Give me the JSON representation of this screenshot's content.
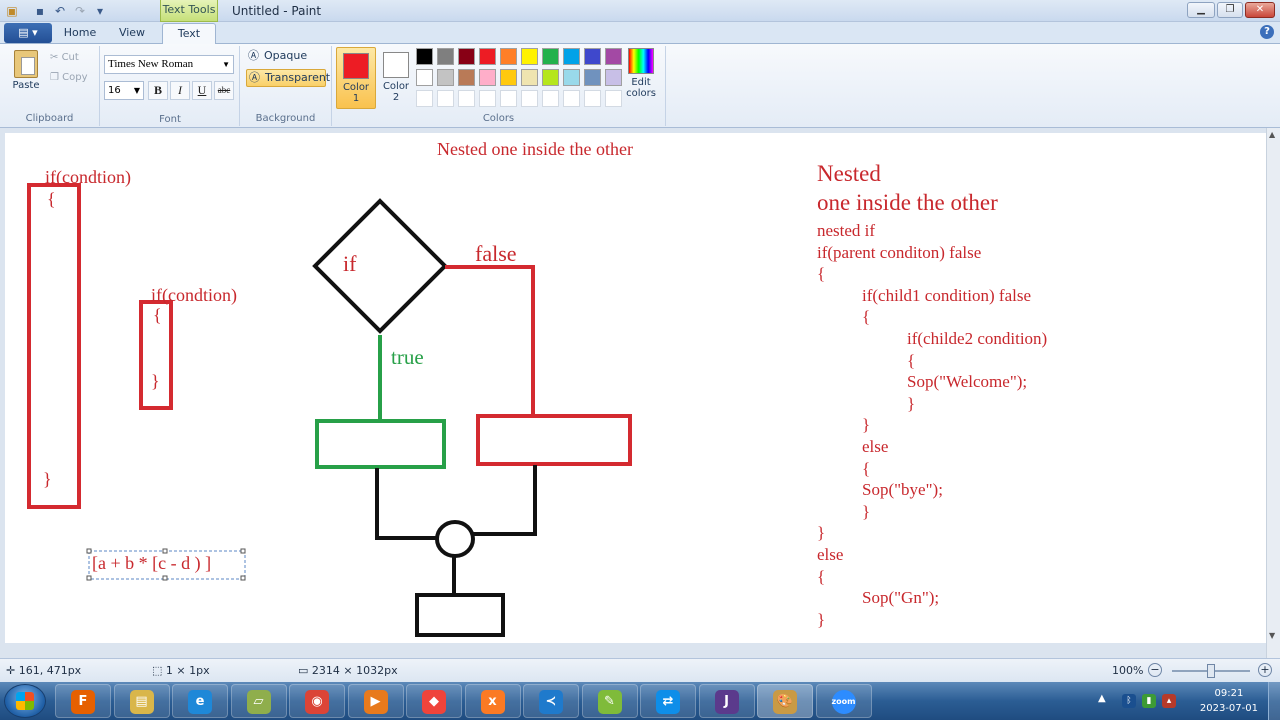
{
  "window": {
    "title": "Untitled - Paint",
    "context_tab": "Text Tools"
  },
  "tabs": [
    {
      "label": "Home"
    },
    {
      "label": "View"
    },
    {
      "label": "Text"
    }
  ],
  "ribbon": {
    "clipboard": {
      "paste": "Paste",
      "cut": "Cut",
      "copy": "Copy",
      "label": "Clipboard"
    },
    "font": {
      "name": "Times New Roman",
      "size": "16",
      "bold": "B",
      "italic": "I",
      "underline": "U",
      "strike": "abc",
      "label": "Font"
    },
    "background": {
      "opaque": "Opaque",
      "transparent": "Transparent",
      "label": "Background"
    },
    "colors": {
      "color1": {
        "label": "Color",
        "num": "1",
        "value": "#ed1c24"
      },
      "color2": {
        "label": "Color",
        "num": "2",
        "value": "#ffffff"
      },
      "edit_label": "Edit",
      "edit_label2": "colors",
      "label": "Colors",
      "palette_row1": [
        "#000000",
        "#7f7f7f",
        "#880015",
        "#ed1c24",
        "#ff7f27",
        "#fff200",
        "#22b14c",
        "#00a2e8",
        "#3f48cc",
        "#a349a4"
      ],
      "palette_row2": [
        "#ffffff",
        "#c3c3c3",
        "#b97a57",
        "#ffaec9",
        "#ffc90e",
        "#efe4b0",
        "#b5e61d",
        "#99d9ea",
        "#7092be",
        "#c8bfe7"
      ],
      "palette_row3": [
        "#ffffff",
        "#ffffff",
        "#ffffff",
        "#ffffff",
        "#ffffff",
        "#ffffff",
        "#ffffff",
        "#ffffff",
        "#ffffff",
        "#ffffff"
      ]
    }
  },
  "canvas": {
    "top_title": "Nested one inside the other",
    "outer_if": "if(condtion)",
    "outer_open": "{",
    "outer_close": "}",
    "inner_if": "if(condtion)",
    "inner_open": "{",
    "inner_close": "}",
    "expression": "[a + b * [c - d ) ]",
    "diamond_label": "if",
    "false_label": "false",
    "true_label": "true",
    "right_heading1": "Nested",
    "right_heading2": "one inside the other",
    "code_lines": [
      {
        "text": "nested if",
        "indent": 0
      },
      {
        "text": "if(parent conditon) false",
        "indent": 0
      },
      {
        "text": "{",
        "indent": 0
      },
      {
        "text": "if(child1 condition) false",
        "indent": 1
      },
      {
        "text": "{",
        "indent": 1
      },
      {
        "text": "if(childe2 condition)",
        "indent": 2
      },
      {
        "text": "{",
        "indent": 2
      },
      {
        "text": "Sop(\"Welcome\");",
        "indent": 2
      },
      {
        "text": "}",
        "indent": 2
      },
      {
        "text": "}",
        "indent": 1
      },
      {
        "text": "else",
        "indent": 1
      },
      {
        "text": "{",
        "indent": 1
      },
      {
        "text": "Sop(\"bye\");",
        "indent": 1
      },
      {
        "text": "}",
        "indent": 1
      },
      {
        "text": "}",
        "indent": 0
      },
      {
        "text": "else",
        "indent": 0
      },
      {
        "text": "{",
        "indent": 0
      },
      {
        "text": "Sop(\"Gn\");",
        "indent": 1
      },
      {
        "text": "}",
        "indent": 0
      }
    ]
  },
  "status": {
    "cursor": "161, 471px",
    "selection": "1 × 1px",
    "canvas_size": "2314 × 1032px",
    "zoom": "100%"
  },
  "taskbar": {
    "apps": [
      {
        "name": "firefox-icon",
        "color": "#e66000",
        "glyph": "F"
      },
      {
        "name": "explorer-icon",
        "color": "#d9b64a",
        "glyph": "▤"
      },
      {
        "name": "ie-icon",
        "color": "#1e88d8",
        "glyph": "e"
      },
      {
        "name": "notes-icon",
        "color": "#8fae4c",
        "glyph": "▱"
      },
      {
        "name": "chrome-icon",
        "color": "#db4437",
        "glyph": "◉"
      },
      {
        "name": "media-player-icon",
        "color": "#e87a1c",
        "glyph": "▶"
      },
      {
        "name": "anydesk-icon",
        "color": "#ef443b",
        "glyph": "◆"
      },
      {
        "name": "xampp-icon",
        "color": "#fb7a24",
        "glyph": "x"
      },
      {
        "name": "vscode-icon",
        "color": "#1f7acc",
        "glyph": "≺"
      },
      {
        "name": "notepadpp-icon",
        "color": "#7fbb3a",
        "glyph": "✎"
      },
      {
        "name": "teamviewer-icon",
        "color": "#0e8ee9",
        "glyph": "⇄"
      },
      {
        "name": "javaee-ide-icon",
        "color": "#5b3a8c",
        "glyph": "J"
      },
      {
        "name": "paint-icon",
        "color": "#c99a45",
        "glyph": "🎨"
      },
      {
        "name": "zoom-icon",
        "color": "#2d8cff",
        "glyph": "zoom"
      }
    ],
    "time": "09:21",
    "date": "2023-07-01"
  }
}
